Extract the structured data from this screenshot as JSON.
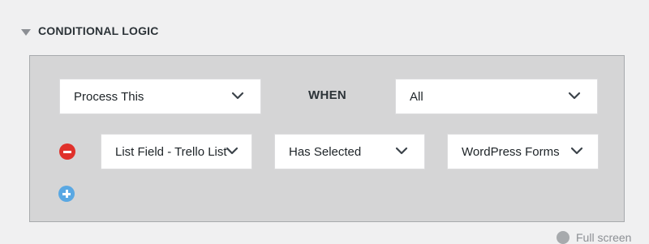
{
  "section": {
    "title": "CONDITIONAL LOGIC"
  },
  "logic": {
    "action": "Process This",
    "when_label": "WHEN",
    "match": "All"
  },
  "rule": {
    "field": "List Field - Trello List",
    "operator": "Has Selected",
    "value": "WordPress Forms"
  },
  "footer": {
    "fullscreen_label": "Full screen"
  },
  "colors": {
    "remove": "#e0312b",
    "add": "#5aa8e3",
    "panel": "#d5d5d6"
  }
}
